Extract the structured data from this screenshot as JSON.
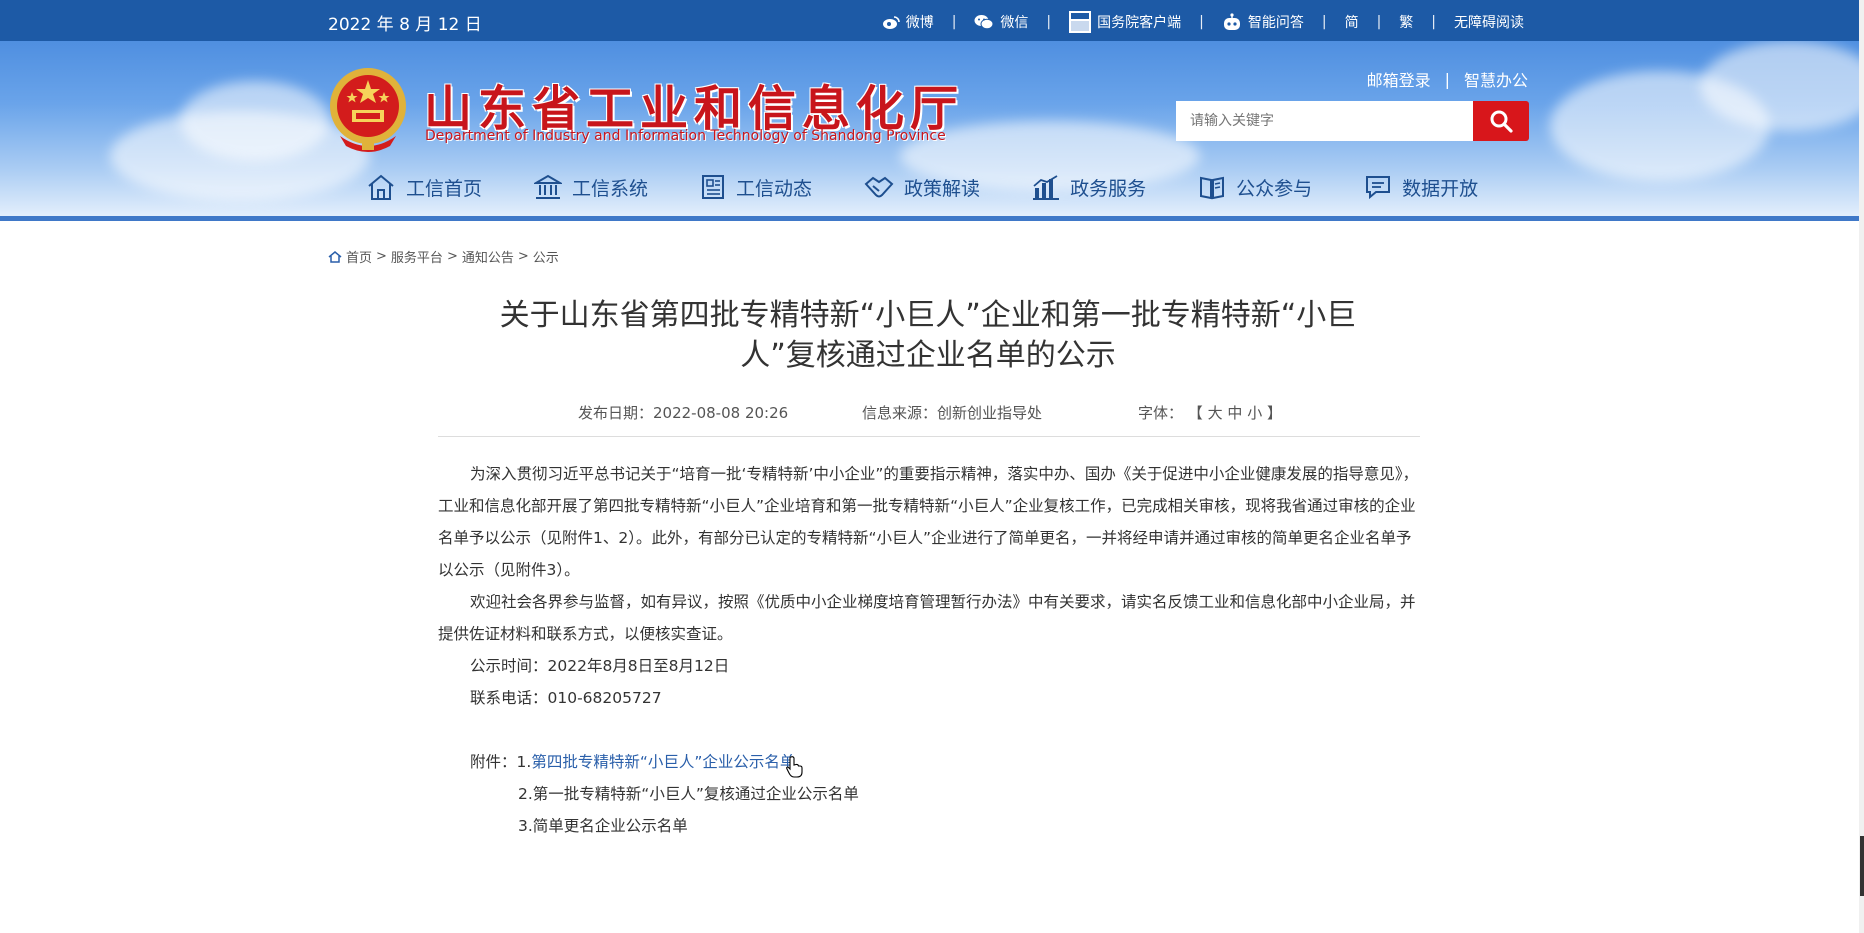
{
  "topbar": {
    "date": "2022 年 8 月 12 日",
    "links": {
      "weibo": "微博",
      "weixin": "微信",
      "gwy": "国务院客户端",
      "ai": "智能问答",
      "simplified": "简",
      "traditional": "繁",
      "accessible": "无障碍阅读"
    },
    "separator": "|"
  },
  "header": {
    "title": "山东省工业和信息化厅",
    "subtitle": "Department of Industry and Information Technology of Shandong Province",
    "mail_login": "邮箱登录",
    "smart_office": "智慧办公",
    "separator": "|",
    "search_placeholder": "请输入关键字"
  },
  "nav": [
    {
      "label": "工信首页",
      "icon": "home-icon"
    },
    {
      "label": "工信系统",
      "icon": "building-icon"
    },
    {
      "label": "工信动态",
      "icon": "news-icon"
    },
    {
      "label": "政策解读",
      "icon": "handshake-icon"
    },
    {
      "label": "政务服务",
      "icon": "chart-icon"
    },
    {
      "label": "公众参与",
      "icon": "book-icon"
    },
    {
      "label": "数据开放",
      "icon": "chat-icon"
    }
  ],
  "breadcrumb": {
    "home": "首页",
    "level2": "服务平台",
    "level3": "通知公告",
    "level4": "公示",
    "sep": ">"
  },
  "article": {
    "title": "关于山东省第四批专精特新“小巨人”企业和第一批专精特新“小巨人”复核通过企业名单的公示",
    "publish_date": "发布日期：2022-08-08 20:26",
    "source": "信息来源：创新创业指导处",
    "font_label": "字体：",
    "font_open": "【",
    "font_large": "大",
    "font_medium": "中",
    "font_small": "小",
    "font_close": "】",
    "para1": "为深入贯彻习近平总书记关于“培育一批‘专精特新’中小企业”的重要指示精神，落实中办、国办《关于促进中小企业健康发展的指导意见》，工业和信息化部开展了第四批专精特新“小巨人”企业培育和第一批专精特新“小巨人”企业复核工作，已完成相关审核，现将我省通过审核的企业名单予以公示（见附件1、2）。此外，有部分已认定的专精特新“小巨人”企业进行了简单更名，一并将经申请并通过审核的简单更名企业名单予以公示（见附件3）。",
    "para2": "欢迎社会各界参与监督，如有异议，按照《优质中小企业梯度培育管理暂行办法》中有关要求，请实名反馈工业和信息化部中小企业局，并提供佐证材料和联系方式，以便核实查证。",
    "period": "公示时间：2022年8月8日至8月12日",
    "phone": "联系电话：010-68205727",
    "attach_label": "附件：",
    "attach1_num": "1.",
    "attach1": "第四批专精特新“小巨人”企业公示名单",
    "attach2": "2.第一批专精特新“小巨人”复核通过企业公示名单",
    "attach3": "3.简单更名企业公示名单"
  },
  "colors": {
    "topbar": "#1d5aa6",
    "brand_red": "#c8151b",
    "search_button": "#d8161b",
    "nav_text": "#1e4f8f",
    "link_blue": "#2a5faa"
  }
}
